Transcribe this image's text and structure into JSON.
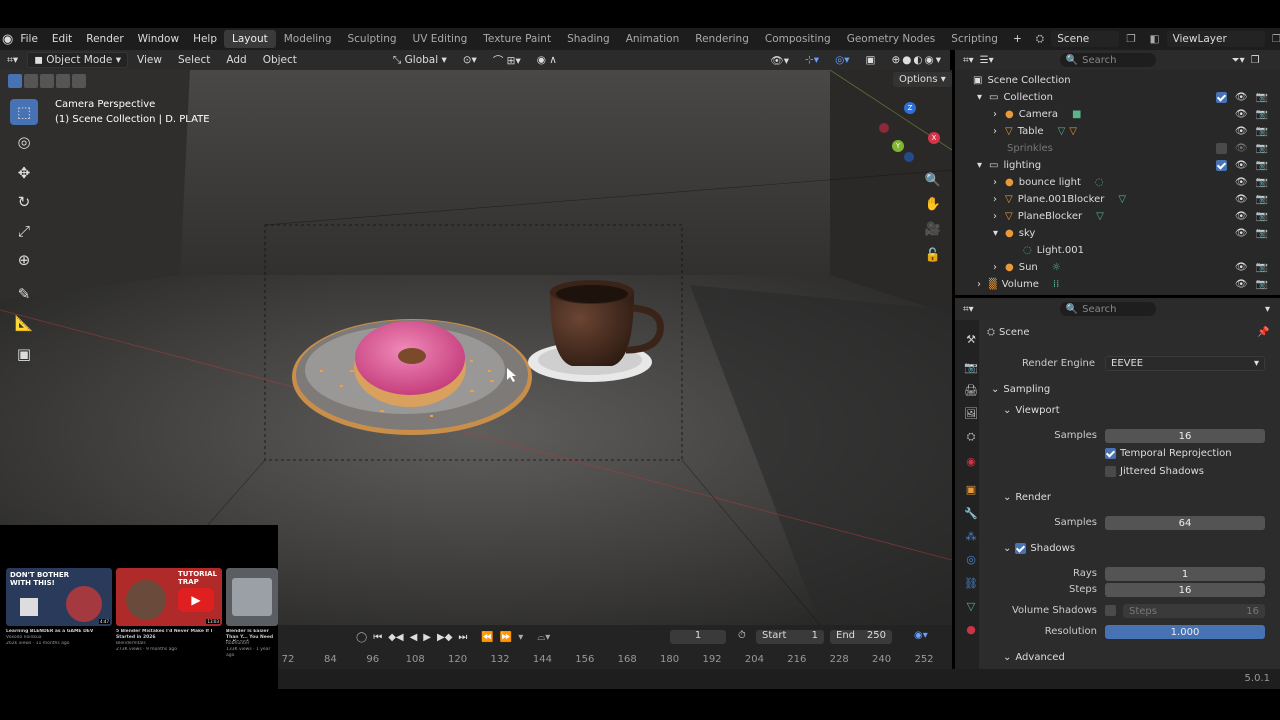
{
  "topbar": {
    "menus": [
      "File",
      "Edit",
      "Render",
      "Window",
      "Help"
    ],
    "workspaces": [
      "Layout",
      "Modeling",
      "Sculpting",
      "UV Editing",
      "Texture Paint",
      "Shading",
      "Animation",
      "Rendering",
      "Compositing",
      "Geometry Nodes",
      "Scripting"
    ],
    "active_workspace": "Layout",
    "scene": "Scene",
    "view_layer": "ViewLayer"
  },
  "viewport_header": {
    "mode": "Object Mode",
    "menus": [
      "View",
      "Select",
      "Add",
      "Object"
    ],
    "orientation": "Global",
    "options": "Options"
  },
  "viewport": {
    "camera_label": "Camera Perspective",
    "collection_label": "(1) Scene Collection | D. PLATE"
  },
  "gizmo": {
    "x": "X",
    "y": "Y",
    "z": "Z"
  },
  "outliner": {
    "search_placeholder": "Search",
    "root": "Scene Collection",
    "items": [
      {
        "label": "Collection"
      },
      {
        "label": "Camera"
      },
      {
        "label": "Table"
      },
      {
        "label": "Sprinkles"
      },
      {
        "label": "lighting"
      },
      {
        "label": "bounce light"
      },
      {
        "label": "Plane.001Blocker"
      },
      {
        "label": "PlaneBlocker"
      },
      {
        "label": "sky"
      },
      {
        "label": "Light.001"
      },
      {
        "label": "Sun"
      },
      {
        "label": "Volume"
      }
    ]
  },
  "properties": {
    "search_placeholder": "Search",
    "scene": "Scene",
    "render_engine_label": "Render Engine",
    "render_engine": "EEVEE",
    "sampling": "Sampling",
    "viewport": "Viewport",
    "samples_label": "Samples",
    "viewport_samples": "16",
    "temporal_reprojection": "Temporal Reprojection",
    "jittered_shadows": "Jittered Shadows",
    "render": "Render",
    "render_samples": "64",
    "shadows": "Shadows",
    "rays_label": "Rays",
    "rays": "1",
    "steps_label": "Steps",
    "steps": "16",
    "volume_shadows_label": "Volume Shadows",
    "vs_steps_label": "Steps",
    "vs_steps": "16",
    "resolution_label": "Resolution",
    "resolution": "1.000",
    "advanced": "Advanced"
  },
  "timeline": {
    "current_frame": "1",
    "start_label": "Start",
    "start": "1",
    "end_label": "End",
    "end": "250",
    "ticks": [
      "72",
      "84",
      "96",
      "108",
      "120",
      "132",
      "144",
      "156",
      "168",
      "180",
      "192",
      "204",
      "216",
      "228",
      "240",
      "252"
    ]
  },
  "version": "5.0.1",
  "thumbnails": [
    {
      "title": "DON'T BOTHER WITH THIS!",
      "caption": "Learning BLENDER as a GAME DEV",
      "meta1": "Voxodo noinkua",
      "meta2": "262k views · 11 months ago",
      "duration": "4:47"
    },
    {
      "title": "TUTORIAL TRAP",
      "caption": "5 Blender Mistakes I'd Never Make If I Started in 2026",
      "meta1": "BlenderVitals",
      "meta2": "273K views · 9 months ago",
      "duration": "13:03"
    },
    {
      "title": "",
      "caption": "Blender Is Easier Than Y... You Need to Know!",
      "meta1": "Robhunter",
      "meta2": "133K views · 1 year ago",
      "duration": ""
    }
  ]
}
